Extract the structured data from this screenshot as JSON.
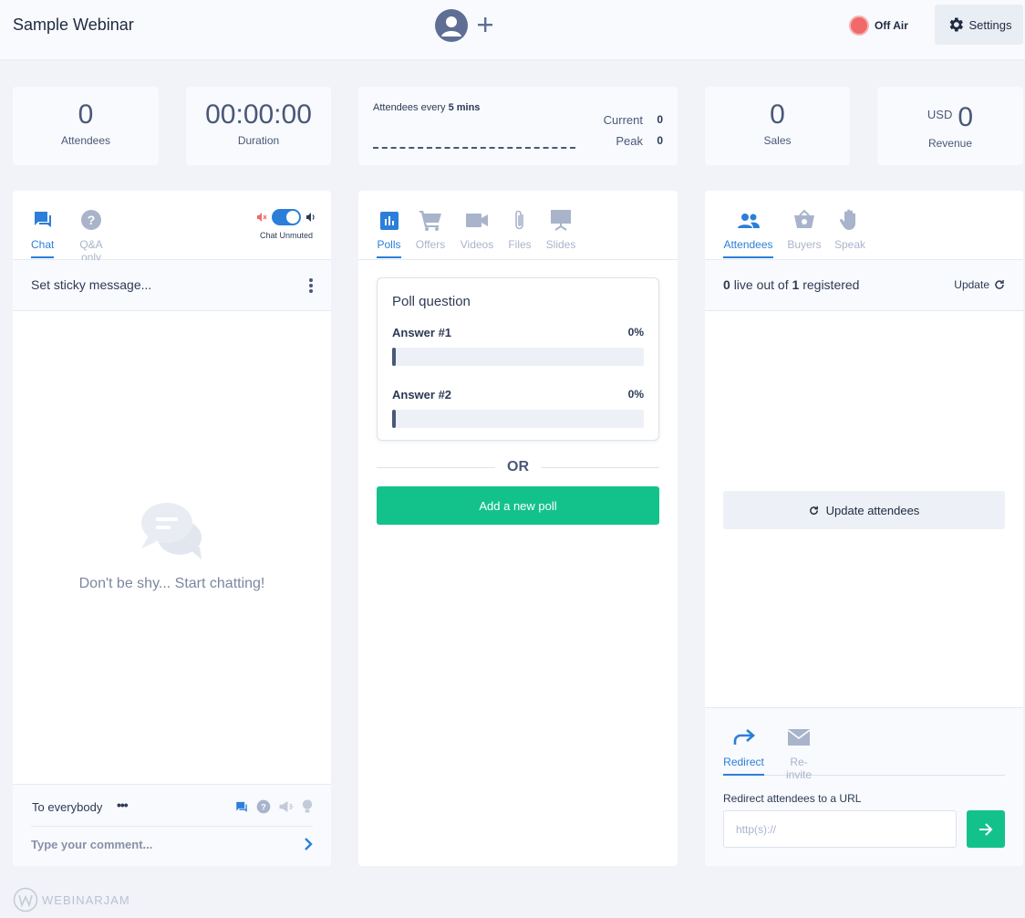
{
  "header": {
    "title": "Sample Webinar",
    "status_label": "Off Air",
    "settings_label": "Settings"
  },
  "stats": {
    "attendees": {
      "value": "0",
      "label": "Attendees"
    },
    "duration": {
      "value": "00:00:00",
      "label": "Duration"
    },
    "graph": {
      "prefix": "Attendees every",
      "interval": "5 mins",
      "current_label": "Current",
      "current_value": "0",
      "peak_label": "Peak",
      "peak_value": "0"
    },
    "sales": {
      "value": "0",
      "label": "Sales"
    },
    "revenue": {
      "currency": "USD",
      "value": "0",
      "label": "Revenue"
    }
  },
  "chat": {
    "tabs": [
      {
        "label": "Chat",
        "icon": "chat-bubble-icon"
      },
      {
        "label": "Q&A only",
        "icon": "question-icon"
      }
    ],
    "toggle_label": "Chat Unmuted",
    "sticky_placeholder": "Set sticky message...",
    "empty_text": "Don't be shy... Start chatting!",
    "recipient": "To everybody",
    "recipient_more": "•••",
    "comment_placeholder": "Type your comment..."
  },
  "polls": {
    "tabs": [
      {
        "label": "Polls",
        "icon": "bar-chart-icon"
      },
      {
        "label": "Offers",
        "icon": "cart-icon"
      },
      {
        "label": "Videos",
        "icon": "video-camera-icon"
      },
      {
        "label": "Files",
        "icon": "paperclip-icon"
      },
      {
        "label": "Slides",
        "icon": "presentation-icon"
      }
    ],
    "question": "Poll question",
    "answers": [
      {
        "label": "Answer #1",
        "percent": "0%",
        "fraction": 0
      },
      {
        "label": "Answer #2",
        "percent": "0%",
        "fraction": 0
      }
    ],
    "or_text": "OR",
    "add_label": "Add a new poll"
  },
  "attendees_panel": {
    "tabs": [
      {
        "label": "Attendees",
        "icon": "people-icon"
      },
      {
        "label": "Buyers",
        "icon": "shopping-basket-icon"
      },
      {
        "label": "Speak",
        "icon": "raised-hand-icon"
      }
    ],
    "live_count": "0",
    "live_mid": "live out of",
    "registered_count": "1",
    "registered_label": "registered",
    "update_label": "Update",
    "update_button_label": "Update attendees",
    "redirect_tabs": [
      {
        "label": "Redirect",
        "icon": "redirect-arrow-icon"
      },
      {
        "label": "Re-invite",
        "icon": "envelope-icon"
      }
    ],
    "redirect_label": "Redirect attendees to a URL",
    "url_placeholder": "http(s)://"
  },
  "footer": {
    "brand": "WEBINARJAM"
  },
  "colors": {
    "accent": "#2b7fd9",
    "green": "#13c28b",
    "off_air": "#f06a6a",
    "dark": "#4a5878"
  }
}
